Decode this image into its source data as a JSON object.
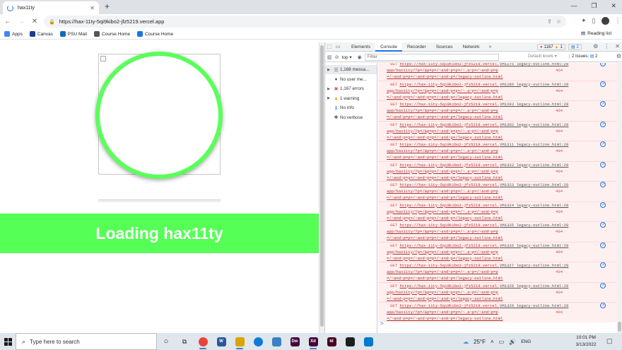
{
  "browser": {
    "tab_title": "hax11ty",
    "url": "https://hax-11ty-5qi9kibo2-jfz5219.vercel.app",
    "bookmarks": [
      {
        "label": "Apps",
        "color": "#4285f4"
      },
      {
        "label": "Canvas",
        "color": "#1e3c8c"
      },
      {
        "label": "PSU Mail",
        "color": "#0f6cbd"
      },
      {
        "label": "Course Home",
        "color": "#555555"
      },
      {
        "label": "Course Home",
        "color": "#1a73e8"
      }
    ],
    "reading_list": "Reading list"
  },
  "page": {
    "banner_text": "Loading hax11ty",
    "banner_color": "#55ff55",
    "circle_color": "#5aff5a"
  },
  "devtools": {
    "tabs": [
      "Elements",
      "Console",
      "Recorder",
      "Sources",
      "Network"
    ],
    "active_tab": "Console",
    "error_count": "1167",
    "warning_count": "1",
    "message_count": "2",
    "context": "top",
    "filter_placeholder": "Filter",
    "levels": "Default levels",
    "issues_label": "2 Issues:",
    "issues_count": "2",
    "sidebar": [
      {
        "label": "1,168 messa...",
        "icon": "list-icon"
      },
      {
        "label": "No user me...",
        "icon": "user-icon"
      },
      {
        "label": "1,167 errors",
        "icon": "error-icon"
      },
      {
        "label": "1 warning",
        "icon": "warning-icon"
      },
      {
        "label": "No info",
        "icon": "info-icon"
      },
      {
        "label": "No verbose",
        "icon": "verbose-icon"
      }
    ],
    "console_url_line1": "https://hax-11ty-5qi9kibo2-jfz5219.vercel.",
    "console_url_line2": "app/hax11ty/?p=/&p=p=/~and~p=p=/~.a~p=/~and~p=p",
    "console_url_line3": "=/~and~p=p=/~and~p=p=/~and~p=/legacy-outline.html",
    "method": "GET",
    "status": "404",
    "rows": [
      {
        "src": "VM1275 legacy-outline.html:29"
      },
      {
        "src": "VM1286 legacy-outline.html:29"
      },
      {
        "src": "VM1293 legacy-outline.html:29"
      },
      {
        "src": "VM1302 legacy-outline.html:29"
      },
      {
        "src": "VM1311 legacy-outline.html:29"
      },
      {
        "src": "VM1322 legacy-outline.html:29"
      },
      {
        "src": "VM1323 legacy-outline.html:29"
      },
      {
        "src": "VM1324 legacy-outline.html:29"
      },
      {
        "src": "VM1325 legacy-outline.html:29"
      },
      {
        "src": "VM1326 legacy-outline.html:29"
      },
      {
        "src": "VM1327 legacy-outline.html:29"
      },
      {
        "src": "VM1328 legacy-outline.html:29"
      },
      {
        "src": "VM1329 legacy-outline.html:29"
      }
    ],
    "prompt": ">"
  },
  "taskbar": {
    "search_placeholder": "Type here to search",
    "weather": "25°F",
    "language": "ENG",
    "time": "10:01 PM",
    "date": "3/13/2022",
    "apps": [
      {
        "name": "chrome",
        "color": "#e8453c",
        "label": "",
        "open": true
      },
      {
        "name": "word",
        "color": "#2b579a",
        "label": "W",
        "open": false
      },
      {
        "name": "files",
        "color": "#d9a400",
        "label": "",
        "open": true
      },
      {
        "name": "edge",
        "color": "#0f7bd6",
        "label": "",
        "open": false
      },
      {
        "name": "app",
        "color": "#3b82c4",
        "label": "",
        "open": false
      },
      {
        "name": "dreamweaver",
        "color": "#470137",
        "label": "Dw",
        "open": false
      },
      {
        "name": "xd",
        "color": "#470137",
        "label": "Xd",
        "open": true
      },
      {
        "name": "indesign",
        "color": "#49021f",
        "label": "Id",
        "open": false
      },
      {
        "name": "terminal",
        "color": "#1e1e1e",
        "label": "",
        "open": false
      },
      {
        "name": "vscode",
        "color": "#007acc",
        "label": "",
        "open": false
      }
    ]
  }
}
